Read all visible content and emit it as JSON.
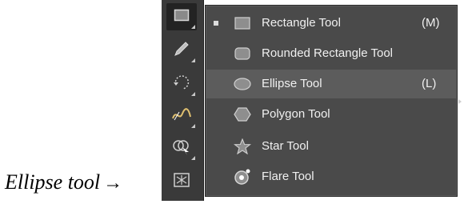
{
  "caption": {
    "text": "Ellipse tool",
    "arrow": "→"
  },
  "toolbar": {
    "buttons": [
      {
        "icon": "rectangle-icon",
        "active": true
      },
      {
        "icon": "pencil-icon"
      },
      {
        "icon": "rotate-icon"
      },
      {
        "icon": "width-icon"
      },
      {
        "icon": "shape-builder-icon"
      },
      {
        "icon": "symbol-sprayer-icon"
      }
    ]
  },
  "flyout": {
    "items": [
      {
        "label": "Rectangle Tool",
        "shortcut": "(M)",
        "icon": "rectangle-icon",
        "selected": true
      },
      {
        "label": "Rounded Rectangle Tool",
        "shortcut": "",
        "icon": "rounded-rectangle-icon"
      },
      {
        "label": "Ellipse Tool",
        "shortcut": "(L)",
        "icon": "ellipse-icon",
        "hovered": true
      },
      {
        "label": "Polygon Tool",
        "shortcut": "",
        "icon": "polygon-icon"
      },
      {
        "label": "Star Tool",
        "shortcut": "",
        "icon": "star-icon"
      },
      {
        "label": "Flare Tool",
        "shortcut": "",
        "icon": "flare-icon"
      }
    ]
  },
  "colors": {
    "panel": "#4a4a4a",
    "toolbar": "#3a3a3a",
    "hover": "#5c5c5c",
    "text": "#f0f0f0"
  }
}
